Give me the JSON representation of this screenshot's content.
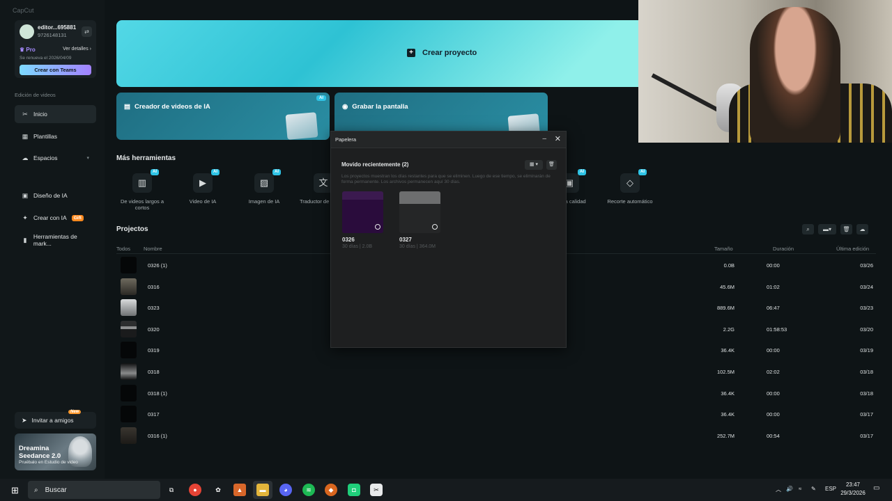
{
  "app": {
    "title": "CapCut"
  },
  "account": {
    "name": "editor...695881",
    "id": "9726148131",
    "plan": "Pro",
    "details_label": "Ver detalles",
    "renewal": "Se renueva el 2026/04/09",
    "teams_button": "Crear con Teams"
  },
  "sidebar": {
    "section_label": "Edición de videos",
    "items": [
      {
        "label": "Inicio",
        "icon": "scissors-icon"
      },
      {
        "label": "Plantillas",
        "icon": "template-icon"
      },
      {
        "label": "Espacios",
        "icon": "cloud-icon"
      },
      {
        "label": "Diseño de IA",
        "icon": "design-icon"
      },
      {
        "label": "Crear con IA",
        "icon": "sparkle-icon",
        "badge": "Gift"
      },
      {
        "label": "Herramientas de mark...",
        "icon": "marketing-icon"
      }
    ],
    "invite": {
      "label": "Invitar a amigos",
      "badge": "New"
    },
    "promo": {
      "title": "Dreamina Seedance 2.0",
      "subtitle": "Pruébalo en Estudio de video"
    }
  },
  "hero": {
    "create_label": "Crear proyecto"
  },
  "cards": [
    {
      "title": "Creador de videos de IA",
      "badge": "AI"
    },
    {
      "title": "Grabar la pantalla"
    }
  ],
  "tools": {
    "title": "Más herramientas",
    "items": [
      {
        "label": "De videos largos a cortos",
        "ai": "AI"
      },
      {
        "label": "Video de IA",
        "ai": "AI"
      },
      {
        "label": "Imagen de IA",
        "ai": "AI"
      },
      {
        "label": "Traductor de",
        "ai": ""
      },
      {
        "label": "la calidad",
        "ai": "AI"
      },
      {
        "label": "Recorte automático",
        "ai": "AI"
      }
    ]
  },
  "projects": {
    "title": "Projectos",
    "headers": {
      "all": "Todos",
      "name": "Nombre",
      "size": "Tamaño",
      "duration": "Duración",
      "last_edit": "Última edición"
    },
    "rows": [
      {
        "name": "0326 (1)",
        "size": "0.0B",
        "duration": "00:00",
        "date": "03/26"
      },
      {
        "name": "0316",
        "size": "45.6M",
        "duration": "01:02",
        "date": "03/24"
      },
      {
        "name": "0323",
        "size": "889.6M",
        "duration": "06:47",
        "date": "03/23"
      },
      {
        "name": "0320",
        "size": "2.2G",
        "duration": "01:58:53",
        "date": "03/20"
      },
      {
        "name": "0319",
        "size": "36.4K",
        "duration": "00:00",
        "date": "03/19"
      },
      {
        "name": "0318",
        "size": "102.5M",
        "duration": "02:02",
        "date": "03/18"
      },
      {
        "name": "0318 (1)",
        "size": "36.4K",
        "duration": "00:00",
        "date": "03/18"
      },
      {
        "name": "0317",
        "size": "36.4K",
        "duration": "00:00",
        "date": "03/17"
      },
      {
        "name": "0316 (1)",
        "size": "252.7M",
        "duration": "00:54",
        "date": "03/17"
      }
    ]
  },
  "trash_dialog": {
    "title": "Papelera",
    "subtitle": "Movido recientemente (2)",
    "note": "Los proyectos muestran los días restantes para que se eliminen. Luego de ese tiempo, se eliminarán de forma permanente. Los archivos permanecen aquí 30 días.",
    "items": [
      {
        "name": "0326",
        "meta": "30 días | 2.0B"
      },
      {
        "name": "0327",
        "meta": "30 días | 364.0M"
      }
    ]
  },
  "taskbar": {
    "search_label": "Buscar",
    "language": "ESP",
    "time": "23:47",
    "date": "29/3/2026"
  },
  "colors": {
    "accent": "#2ec2d4",
    "ai_badge": "#2fc4e6",
    "pro": "#a68bff",
    "gift": "#ff8a1f"
  }
}
